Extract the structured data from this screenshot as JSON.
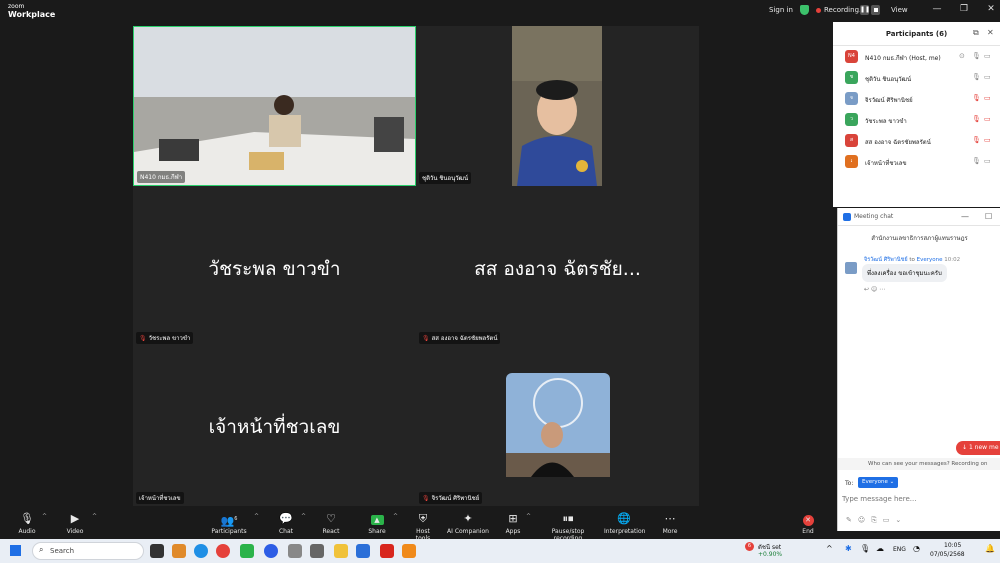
{
  "app": {
    "logo_line1": "zoom",
    "logo_line2": "Workplace"
  },
  "titlebar": {
    "sign_in": "Sign in",
    "recording": "Recording...",
    "view": "View"
  },
  "tiles": [
    {
      "name": "N410 กมธ.กีฬา"
    },
    {
      "name": "ชุติวัน ชินอนุวัฒน์"
    },
    {
      "big": "วัชระพล ขาวขำ",
      "name": "วัชระพล ขาวขำ"
    },
    {
      "big": "สส องอาจ ฉัตรชัย...",
      "name": "สส องอาจ ฉัตรชัยพลรัตน์"
    },
    {
      "big": "เจ้าหน้าที่ชวเลข",
      "name": "เจ้าหน้าที่ชวเลข"
    },
    {
      "name": "จิรวัฒน์ ศิริพานิชย์"
    }
  ],
  "toolbar": {
    "audio": "Audio",
    "video": "Video",
    "participants": "Participants",
    "participants_count": "6",
    "chat": "Chat",
    "react": "React",
    "share": "Share",
    "host_tools": "Host tools",
    "ai_companion": "AI Companion",
    "apps": "Apps",
    "record": "Pause/stop recording",
    "interpretation": "Interpretation",
    "more": "More",
    "end": "End"
  },
  "participants": {
    "title": "Participants (6)",
    "list": [
      {
        "initials": "N4",
        "name": "N410 กมธ.กีฬา (Host, me)",
        "color": "#d9443a",
        "muted": false
      },
      {
        "initials": "ช",
        "name": "ชุติวัน ชินอนุวัฒน์",
        "color": "#3aa55c",
        "muted": false
      },
      {
        "initials": "จ",
        "name": "จิรวัฒน์ ศิริพานิชย์",
        "color": "#7a9cc6",
        "muted": true
      },
      {
        "initials": "ว",
        "name": "วัชระพล ขาวขำ",
        "color": "#3aa55c",
        "muted": true
      },
      {
        "initials": "ส",
        "name": "สส องอาจ ฉัตรชัยพลรัตน์",
        "color": "#d9443a",
        "muted": true
      },
      {
        "initials": "เ",
        "name": "เจ้าหน้าที่ชวเลข",
        "color": "#e07020",
        "muted": false
      }
    ]
  },
  "chat": {
    "title": "Meeting chat",
    "group": "สำนักงานเลขาธิการสภาผู้แทนราษฎร",
    "sender": "จิรวัฒน์ ศิริพานิชย์",
    "to": "to",
    "recipient": "Everyone",
    "time": "10:02",
    "message": "พึ่งลงเครื่อง ขอเข้าชุมนะครับ",
    "new_msg": "1 new me",
    "who_can_see": "Who can see your messages? Recording on",
    "to_label": "To:",
    "to_value": "Everyone",
    "placeholder": "Type message here..."
  },
  "taskbar": {
    "search": "Search",
    "stock_name": "ดัชนี set",
    "stock_change": "+0.90%",
    "lang": "ENG",
    "time": "10:05",
    "date": "07/05/2568",
    "badge": "6"
  }
}
